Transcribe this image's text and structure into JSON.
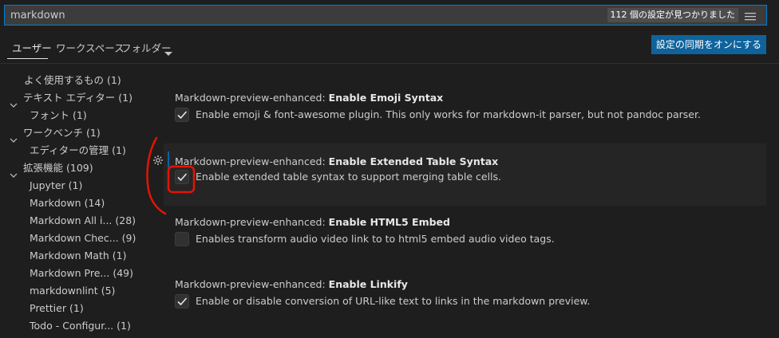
{
  "search": {
    "value": "markdown",
    "result_count": "112 個の設定が見つかりました"
  },
  "tabs": [
    {
      "label": "ユーザー",
      "active": true
    },
    {
      "label": "ワークスペース",
      "active": false
    },
    {
      "label": "フォルダー",
      "active": false
    }
  ],
  "sync_button": "設定の同期をオンにする",
  "toc": [
    {
      "label": "よく使用するもの",
      "count": "(1)",
      "expanded": null
    },
    {
      "label": "テキスト エディター",
      "count": "(1)",
      "expanded": true
    },
    {
      "label": "フォント",
      "count": "(1)",
      "expanded": null
    },
    {
      "label": "ワークベンチ",
      "count": "(1)",
      "expanded": true
    },
    {
      "label": "エディターの管理",
      "count": "(1)",
      "expanded": null
    },
    {
      "label": "拡張機能",
      "count": "(109)",
      "expanded": true
    },
    {
      "label": "Jupyter",
      "count": "(1)",
      "expanded": null
    },
    {
      "label": "Markdown",
      "count": "(14)",
      "expanded": null
    },
    {
      "label": "Markdown All i...",
      "count": "(28)",
      "expanded": null
    },
    {
      "label": "Markdown Chec...",
      "count": "(9)",
      "expanded": null
    },
    {
      "label": "Markdown Math",
      "count": "(1)",
      "expanded": null
    },
    {
      "label": "Markdown Pre...",
      "count": "(49)",
      "expanded": null
    },
    {
      "label": "markdownlint",
      "count": "(5)",
      "expanded": null
    },
    {
      "label": "Prettier",
      "count": "(1)",
      "expanded": null
    },
    {
      "label": "Todo - Configur...",
      "count": "(1)",
      "expanded": null
    }
  ],
  "settings": [
    {
      "category": "Markdown-preview-enhanced: ",
      "label": "Enable Emoji Syntax",
      "description": "Enable emoji & font-awesome plugin. This only works for markdown-it parser, but not pandoc parser.",
      "checked": true,
      "focused": false
    },
    {
      "category": "Markdown-preview-enhanced: ",
      "label": "Enable Extended Table Syntax",
      "description": "Enable extended table syntax to support merging table cells.",
      "checked": true,
      "focused": true
    },
    {
      "category": "Markdown-preview-enhanced: ",
      "label": "Enable HTML5 Embed",
      "description": "Enables transform audio video link to to html5 embed audio video tags.",
      "checked": false,
      "focused": false
    },
    {
      "category": "Markdown-preview-enhanced: ",
      "label": "Enable Linkify",
      "description": "Enable or disable conversion of URL-like text to links in the markdown preview.",
      "checked": true,
      "focused": false
    }
  ],
  "colors": {
    "background": "#1e1e1e",
    "accent": "#0e639c",
    "annotation": "#e51400"
  }
}
